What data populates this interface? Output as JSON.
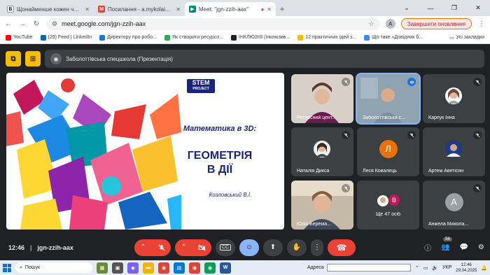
{
  "browser": {
    "tabs": [
      {
        "icon_letter": "Б",
        "icon_color": "#ffffff",
        "icon_text_color": "#202124",
        "title": "Щонайменше кожен четвертий",
        "active": false
      },
      {
        "icon_letter": "M",
        "icon_color": "#ea4335",
        "icon_text_color": "#ffffff",
        "title": "Посилання - a.mykolaichuk@vip",
        "active": false
      },
      {
        "icon_letter": "▶",
        "icon_color": "#00897b",
        "icon_text_color": "#ffffff",
        "title": "Meet: \"jgn-zzih-aax\"",
        "active": true
      }
    ],
    "new_tab": "+",
    "window_controls": [
      "⌄",
      "—",
      "❐",
      "✕"
    ],
    "url": "meet.google.com/jgn-zzih-aax",
    "profile_letter": "A",
    "update_button": "Завершити оновлення",
    "bookmarks": [
      {
        "label": "YouTube",
        "color": "#ff0000"
      },
      {
        "label": "(29) Feed | LinkedIn",
        "color": "#0a66c2"
      },
      {
        "label": "Директору про робо...",
        "color": "#1a73e8"
      },
      {
        "label": "Як створити ресурсо...",
        "color": "#34a853"
      },
      {
        "label": "ІНКЛЮЗІЯ (Інклюзив...",
        "color": "#202124"
      },
      {
        "label": "12 практичних ідей з...",
        "color": "#fbbc04"
      },
      {
        "label": "Що таке «Довідник б...",
        "color": "#4285f4"
      }
    ],
    "all_bookmarks": "Усі закладки"
  },
  "meet": {
    "presentation_label": "Заболоттівська спецшкола (Презентація)",
    "slide": {
      "logo_main": "STEM",
      "logo_sub": "PROJECT",
      "subtitle": "Математика в 3D:",
      "title_line1": "ГЕОМЕТРІЯ",
      "title_line2": "В ДІЇ",
      "author": "Козловський В.І."
    },
    "participants": [
      {
        "name": "Ресурсний цент...",
        "type": "photo",
        "mic": "muted"
      },
      {
        "name": "Заболоттівська с...",
        "type": "photo",
        "mic": "speaking"
      },
      {
        "name": "Карпук Інна",
        "type": "photo-small",
        "mic": "muted"
      },
      {
        "name": "Наталія Дикса",
        "type": "photo-small",
        "mic": "muted"
      },
      {
        "name": "Леся Ковалець",
        "type": "letter",
        "letter": "Л",
        "color": "#e8710a",
        "mic": "muted"
      },
      {
        "name": "Артем Аветісян",
        "type": "photo-small",
        "mic": "muted"
      },
      {
        "name": "Юлія Берема...",
        "type": "photo",
        "mic": "muted"
      },
      {
        "name": "Ще 47 осіб",
        "type": "more",
        "letter": "В",
        "color": "#c2185b",
        "mic": "none"
      },
      {
        "name": "Анжела Микола...",
        "type": "letter",
        "letter": "А",
        "color": "#9aa0a6",
        "mic": "muted"
      }
    ],
    "time": "12:46",
    "meeting_code": "jgn-zzih-aax",
    "people_count": "56"
  },
  "taskbar": {
    "search_placeholder": "Пошук",
    "address_label": "Адреса",
    "lang": "УКР",
    "clock_time": "12:46",
    "clock_date": "29.04.2025"
  },
  "colors": {
    "accent": "#8ab4f8",
    "danger": "#ea4335",
    "present_button": "#fbbc04"
  }
}
